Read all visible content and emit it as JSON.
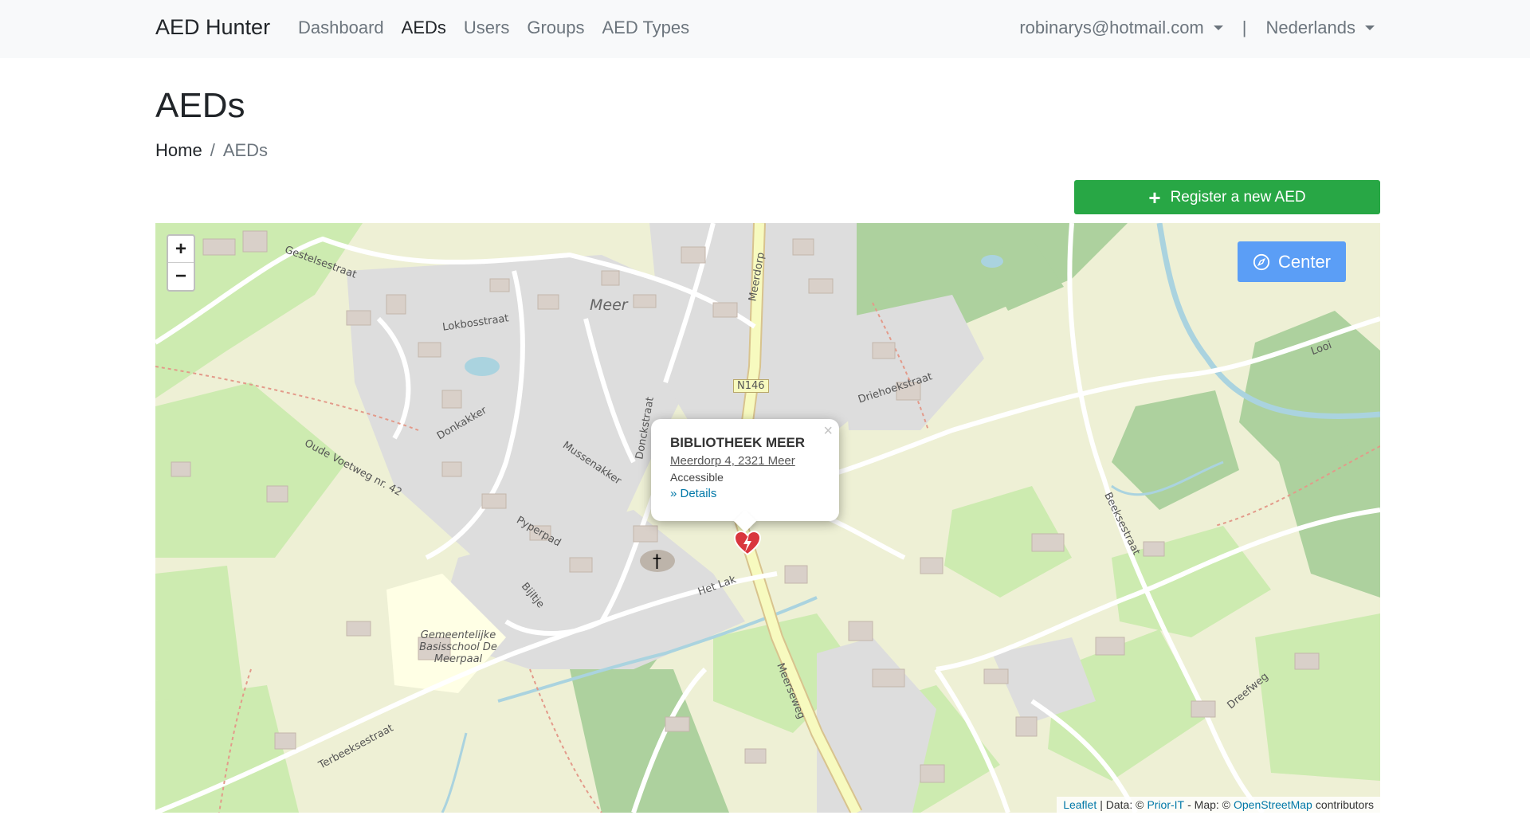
{
  "navbar": {
    "brand": "AED Hunter",
    "links": [
      {
        "label": "Dashboard",
        "active": false
      },
      {
        "label": "AEDs",
        "active": true
      },
      {
        "label": "Users",
        "active": false
      },
      {
        "label": "Groups",
        "active": false
      },
      {
        "label": "AED Types",
        "active": false
      }
    ],
    "user_email": "robinarys@hotmail.com",
    "separator": "|",
    "language": "Nederlands"
  },
  "page": {
    "title": "AEDs",
    "breadcrumb": {
      "home": "Home",
      "separator": "/",
      "current": "AEDs"
    },
    "register_button": "Register a new AED"
  },
  "map": {
    "zoom_in": "+",
    "zoom_out": "−",
    "center_button": "Center",
    "popup": {
      "close": "×",
      "name": "BIBLIOTHEEK MEER",
      "address": "Meerdorp 4, 2321 Meer",
      "status": "Accessible",
      "details": "» Details"
    },
    "labels": {
      "meer": "Meer",
      "n146": "N146",
      "gestelsestraat": "Gestelsestraat",
      "lokbosstraat": "Lokbosstraat",
      "meerdorp": "Meerdorp",
      "donkakker": "Donkakker",
      "mussenakker": "Mussenakker",
      "donckstraat": "Donckstraat",
      "drieboekstraat": "Driehoekstraat",
      "oude_voetweg": "Oude Voetweg nr. 42",
      "pyperpad": "Pyperpad",
      "bijltje": "Bijltje",
      "het_lak": "Het Lak",
      "school": "Gemeentelijke Basisschool De Meerpaal",
      "terbeeksestraat": "Terbeeksestraat",
      "meerseweg": "Meerseweg",
      "beeksestraat": "Beeksestraat",
      "looi": "Looi",
      "dreefweg": "Dreefweg"
    },
    "attribution": {
      "leaflet": "Leaflet",
      "data_prefix": "| Data: ©",
      "prior": "Prior-IT",
      "map_prefix": "- Map: ©",
      "osm": "OpenStreetMap",
      "suffix": "contributors"
    },
    "colors": {
      "marker": "#d9363e",
      "main_road": "#f7fabf",
      "water": "#aad3df"
    }
  }
}
